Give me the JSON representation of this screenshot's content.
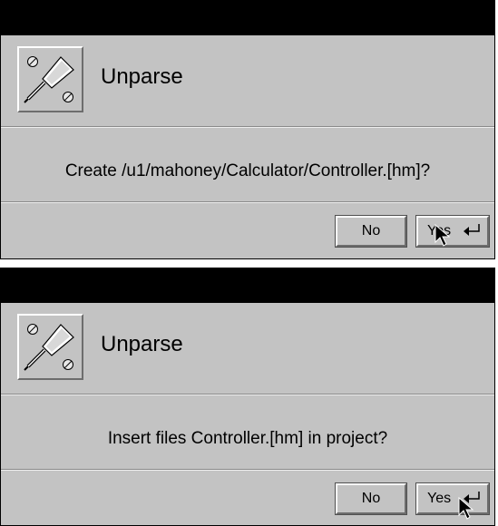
{
  "dialogs": [
    {
      "title": "Unparse",
      "message": "Create /u1/mahoney/Calculator/Controller.[hm]?",
      "buttons": {
        "no": "No",
        "yes": "Yes"
      },
      "icon": "screwdriver-icon"
    },
    {
      "title": "Unparse",
      "message": "Insert files Controller.[hm] in project?",
      "buttons": {
        "no": "No",
        "yes": "Yes"
      },
      "icon": "screwdriver-icon"
    }
  ],
  "colors": {
    "panel": "#c3c3c3",
    "titlebar": "#000000",
    "highlight": "#ffffff",
    "shadow": "#6d6d6d"
  }
}
